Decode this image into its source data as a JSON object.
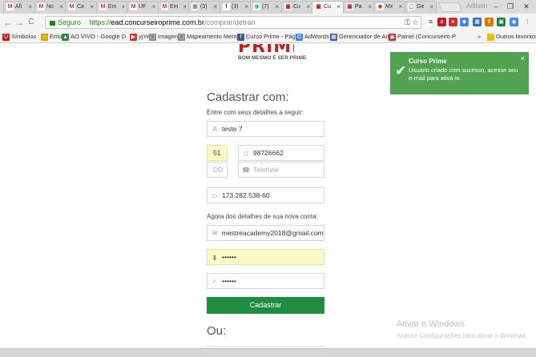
{
  "browser": {
    "tabs": [
      {
        "title": "Afi",
        "color": "#d93025",
        "glyph": "M"
      },
      {
        "title": "No",
        "color": "#d93025",
        "glyph": "M"
      },
      {
        "title": "Ca",
        "color": "#d93025",
        "glyph": "M"
      },
      {
        "title": "Em",
        "color": "#d93025",
        "glyph": "M"
      },
      {
        "title": "UF",
        "color": "#d93025",
        "glyph": "M"
      },
      {
        "title": "Em",
        "color": "#d93025",
        "glyph": "M"
      },
      {
        "title": "(3)",
        "color": "#7a8a99",
        "glyph": "▦"
      },
      {
        "title": "(3)",
        "color": "#3b5998",
        "glyph": "f"
      },
      {
        "title": "(7)",
        "color": "#25d366",
        "glyph": "◉"
      },
      {
        "title": "Cu",
        "color": "#c51c1c",
        "glyph": "▣"
      },
      {
        "title": "Cu",
        "color": "#c51c1c",
        "glyph": "▣",
        "active": true
      },
      {
        "title": "Pa",
        "color": "#c51c1c",
        "glyph": "▣"
      },
      {
        "title": "Mx",
        "color": "#c2410c",
        "glyph": "◆"
      },
      {
        "title": "Ge",
        "color": "#888888",
        "glyph": "▢"
      }
    ],
    "user": "Adilson",
    "window_controls": {
      "minimize": "–",
      "restore": "❐",
      "close": "✕"
    },
    "security_label": "Seguro",
    "url_prefix": "https://",
    "url_host": "ead.concurseiroprime.com.br",
    "url_path": "/comprar/detran",
    "nav": {
      "back": "←",
      "forward": "→",
      "reload": "C",
      "home": "⌂"
    },
    "bookmarks": [
      {
        "label": "Símbolos",
        "color": "#c51c1c",
        "glyph": "Ü"
      },
      {
        "label": "Emoji",
        "color": "#e0a400",
        "glyph": "☺"
      },
      {
        "label": "AO VIVO - Google D",
        "color": "#1e8e3e",
        "glyph": "▲"
      },
      {
        "label": "yjYeL",
        "color": "#d93025",
        "glyph": "▶"
      },
      {
        "label": "Imagens",
        "color": "#888888",
        "glyph": "▢"
      },
      {
        "label": "Mapeamento Mental",
        "color": "#888888",
        "glyph": "▢"
      },
      {
        "label": "Curso Prime - Página",
        "color": "#3b5998",
        "glyph": "f"
      },
      {
        "label": "AdWords",
        "color": "#4285f4",
        "glyph": "G"
      },
      {
        "label": "Gerenciador de Anún",
        "color": "#3b5998",
        "glyph": "▦"
      },
      {
        "label": "Painel (Concurseiro P",
        "color": "#c51c1c",
        "glyph": "▣"
      }
    ],
    "bookmarks_more": "»",
    "other_bookmarks": "Outros favoritos"
  },
  "page": {
    "logo_text": "PRIME",
    "slogan": "BOM MESMO É SER PRIME",
    "form_title": "Cadastrar com:",
    "subtitle": "Entre com seus detalhes a seguir:",
    "name_value": "teste 7",
    "ddd1_value": "51",
    "phone1_value": "98726662",
    "ddd2_placeholder": "DD",
    "phone2_placeholder": "Telefone",
    "cpf_value": "173.282.538-60",
    "account_section": "Agora dos detalhes de sua nova conta:",
    "email_value": "mestreacademy2018@gmail.com",
    "password_value": "••••••",
    "password_confirm_value": "••••••",
    "submit_label": "Cadastrar",
    "or_label": "Ou:"
  },
  "toast": {
    "title": "Curso Prime",
    "message": "Usuário criado com sucesso, acesse seu e-mail para ativá-lo",
    "close": "×",
    "color": "#51a351"
  },
  "watermark": {
    "title": "Ativar o Windows",
    "subtitle": "Acesse Configurações para ativar o Windows."
  },
  "colors": {
    "accent_green": "#1e8e3e",
    "brand_red": "#c51c1c",
    "autofill_yellow": "#fbfbc6"
  }
}
